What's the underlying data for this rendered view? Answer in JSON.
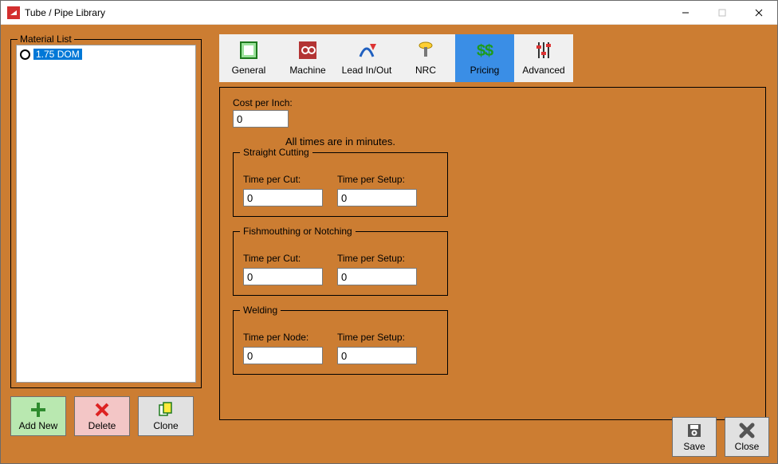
{
  "window": {
    "title": "Tube / Pipe Library"
  },
  "material_list": {
    "legend": "Material List",
    "items": [
      {
        "label": "1.75 DOM",
        "selected": true
      }
    ]
  },
  "list_actions": {
    "add_new": "Add New",
    "delete": "Delete",
    "clone": "Clone"
  },
  "tabs": [
    {
      "id": "general",
      "label": "General"
    },
    {
      "id": "machine",
      "label": "Machine"
    },
    {
      "id": "leadinout",
      "label": "Lead In/Out"
    },
    {
      "id": "nrc",
      "label": "NRC"
    },
    {
      "id": "pricing",
      "label": "Pricing",
      "active": true
    },
    {
      "id": "advanced",
      "label": "Advanced"
    }
  ],
  "pricing": {
    "cost_per_inch_label": "Cost per Inch:",
    "cost_per_inch_value": "0",
    "info_text": "All times are in minutes.",
    "straight": {
      "legend": "Straight Cutting",
      "time_per_cut_label": "Time per Cut:",
      "time_per_cut_value": "0",
      "time_per_setup_label": "Time per Setup:",
      "time_per_setup_value": "0"
    },
    "fishmouth": {
      "legend": "Fishmouthing or Notching",
      "time_per_cut_label": "Time per Cut:",
      "time_per_cut_value": "0",
      "time_per_setup_label": "Time per Setup:",
      "time_per_setup_value": "0"
    },
    "welding": {
      "legend": "Welding",
      "time_per_node_label": "Time per Node:",
      "time_per_node_value": "0",
      "time_per_setup_label": "Time per Setup:",
      "time_per_setup_value": "0"
    }
  },
  "footer": {
    "save": "Save",
    "close": "Close"
  }
}
